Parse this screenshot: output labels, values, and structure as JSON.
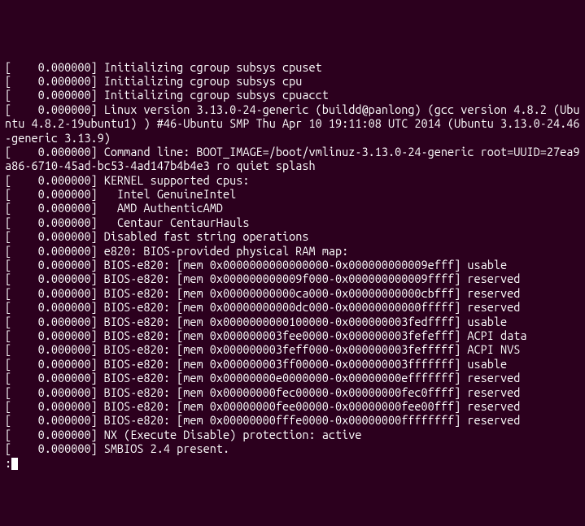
{
  "lines": [
    "[    0.000000] Initializing cgroup subsys cpuset",
    "[    0.000000] Initializing cgroup subsys cpu",
    "[    0.000000] Initializing cgroup subsys cpuacct",
    "[    0.000000] Linux version 3.13.0-24-generic (buildd@panlong) (gcc version 4.8.2 (Ubuntu 4.8.2-19ubuntu1) ) #46-Ubuntu SMP Thu Apr 10 19:11:08 UTC 2014 (Ubuntu 3.13.0-24.46-generic 3.13.9)",
    "[    0.000000] Command line: BOOT_IMAGE=/boot/vmlinuz-3.13.0-24-generic root=UUID=27ea9a86-6710-45ad-bc53-4ad147b4b4e3 ro quiet splash",
    "[    0.000000] KERNEL supported cpus:",
    "[    0.000000]   Intel GenuineIntel",
    "[    0.000000]   AMD AuthenticAMD",
    "[    0.000000]   Centaur CentaurHauls",
    "[    0.000000] Disabled fast string operations",
    "[    0.000000] e820: BIOS-provided physical RAM map:",
    "[    0.000000] BIOS-e820: [mem 0x0000000000000000-0x000000000009efff] usable",
    "[    0.000000] BIOS-e820: [mem 0x000000000009f000-0x000000000009ffff] reserved",
    "[    0.000000] BIOS-e820: [mem 0x00000000000ca000-0x00000000000cbfff] reserved",
    "[    0.000000] BIOS-e820: [mem 0x00000000000dc000-0x00000000000fffff] reserved",
    "[    0.000000] BIOS-e820: [mem 0x0000000000100000-0x000000003fedffff] usable",
    "[    0.000000] BIOS-e820: [mem 0x000000003fee0000-0x000000003fefefff] ACPI data",
    "[    0.000000] BIOS-e820: [mem 0x000000003feff000-0x000000003fefffff] ACPI NVS",
    "[    0.000000] BIOS-e820: [mem 0x000000003ff00000-0x000000003fffffff] usable",
    "[    0.000000] BIOS-e820: [mem 0x00000000e0000000-0x00000000efffffff] reserved",
    "[    0.000000] BIOS-e820: [mem 0x00000000fec00000-0x00000000fec0ffff] reserved",
    "[    0.000000] BIOS-e820: [mem 0x00000000fee00000-0x00000000fee00fff] reserved",
    "[    0.000000] BIOS-e820: [mem 0x00000000fffe0000-0x00000000ffffffff] reserved",
    "[    0.000000] NX (Execute Disable) protection: active",
    "[    0.000000] SMBIOS 2.4 present."
  ],
  "prompt": ":"
}
